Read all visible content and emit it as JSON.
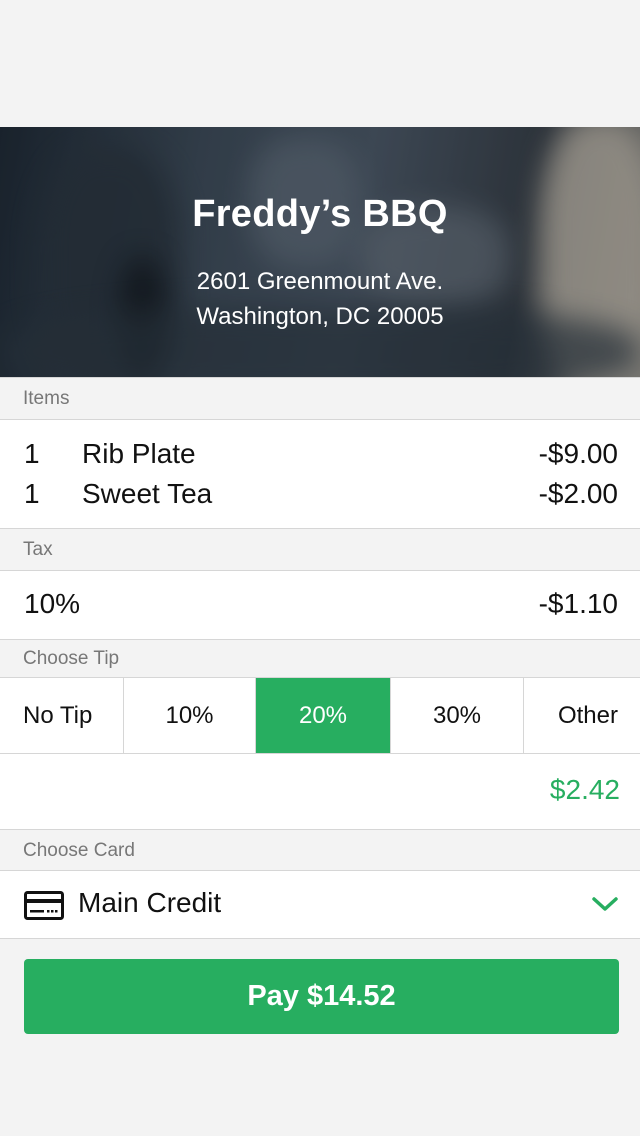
{
  "restaurant": {
    "name": "Freddy’s BBQ",
    "address_line1": "2601 Greenmount Ave.",
    "address_line2": "Washington, DC 20005"
  },
  "items": {
    "label": "Items",
    "rows": [
      {
        "qty": "1",
        "name": "Rib Plate",
        "price": "-$9.00"
      },
      {
        "qty": "1",
        "name": "Sweet Tea",
        "price": "-$2.00"
      }
    ]
  },
  "tax": {
    "label": "Tax",
    "rate": "10%",
    "amount": "-$1.10"
  },
  "tip": {
    "label": "Choose Tip",
    "options": [
      "No Tip",
      "10%",
      "20%",
      "30%",
      "Other"
    ],
    "selected": "20%",
    "amount": "$2.42"
  },
  "card": {
    "label": "Choose Card",
    "selected": "Main Credit",
    "icon": "credit-card-icon"
  },
  "pay": {
    "label": "Pay $14.52"
  },
  "colors": {
    "accent": "#27ae60",
    "background": "#f3f3f3",
    "divider": "#d6d6d6"
  }
}
